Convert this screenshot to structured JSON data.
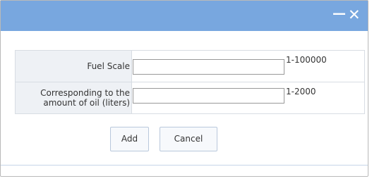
{
  "window": {
    "minimize_label": "—",
    "close_label": "✕"
  },
  "form": {
    "rows": [
      {
        "label": "Fuel Scale",
        "value": "",
        "hint": "1-100000"
      },
      {
        "label": "Corresponding to the amount of oil (liters)",
        "value": "",
        "hint": "1-2000"
      }
    ]
  },
  "buttons": {
    "add": "Add",
    "cancel": "Cancel"
  },
  "colors": {
    "titlebar": "#78a7df",
    "label_bg": "#eef1f5"
  }
}
